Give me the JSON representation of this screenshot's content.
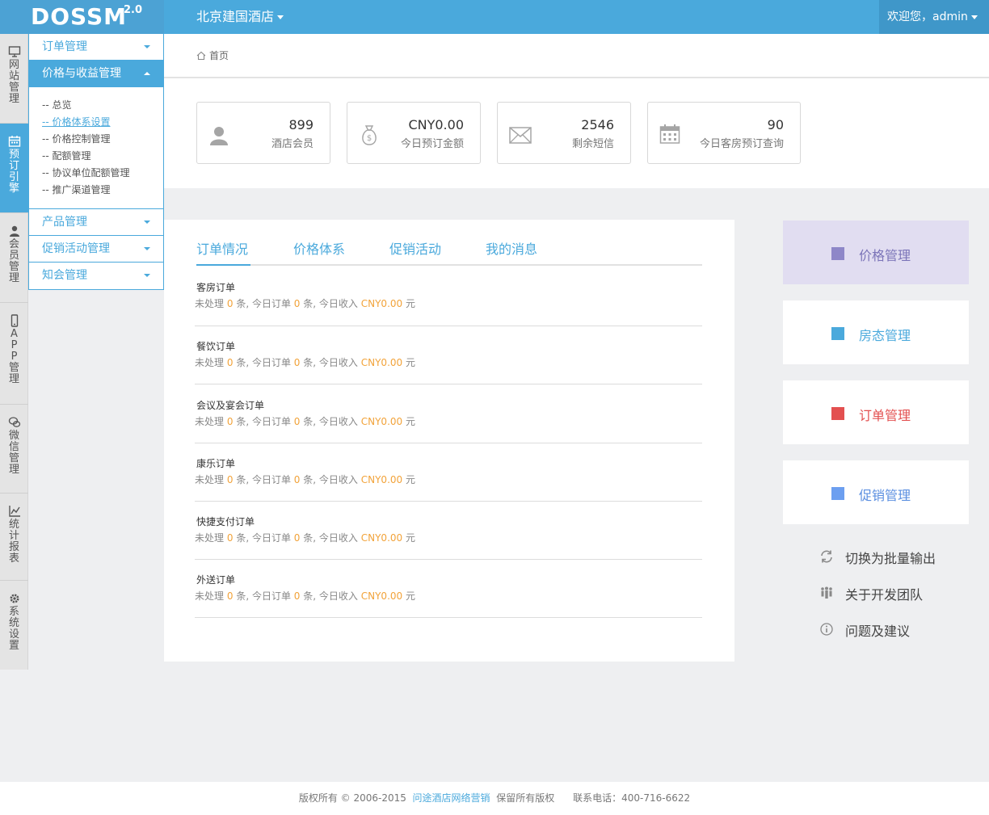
{
  "brand": {
    "logo": "DOSSM",
    "version": "2.0"
  },
  "header": {
    "hotel": "北京建国酒店",
    "welcome": "欢迎您，admin"
  },
  "rail": [
    {
      "label": "网站管理",
      "icon": "monitor-icon"
    },
    {
      "label": "预订引擎",
      "icon": "calendar-icon"
    },
    {
      "label": "会员管理",
      "icon": "user-icon"
    },
    {
      "label": "APP管理",
      "icon": "phone-icon"
    },
    {
      "label": "微信管理",
      "icon": "chat-icon"
    },
    {
      "label": "统计报表",
      "icon": "chart-icon"
    },
    {
      "label": "系统设置",
      "icon": "settings-icon"
    }
  ],
  "submenu": {
    "order": "订单管理",
    "pricing": "价格与收益管理",
    "pricing_items": [
      "-- 总览",
      "-- 价格体系设置",
      "-- 价格控制管理",
      "-- 配额管理",
      "-- 协议单位配额管理",
      "-- 推广渠道管理"
    ],
    "product": "产品管理",
    "promo": "促销活动管理",
    "meeting": "知会管理"
  },
  "breadcrumb": {
    "home": "首页"
  },
  "stats": [
    {
      "value": "899",
      "label": "酒店会员"
    },
    {
      "value": "CNY0.00",
      "label": "今日预订金额"
    },
    {
      "value": "2546",
      "label": "剩余短信"
    },
    {
      "value": "90",
      "label": "今日客房预订查询"
    }
  ],
  "tabs": [
    "订单情况",
    "价格体系",
    "促销活动",
    "我的消息"
  ],
  "info": {
    "pending": "未处理",
    "unit": "条",
    "today_orders": ", 今日订单",
    "today_income": ", 今日收入",
    "yuan": "元"
  },
  "orders": [
    {
      "title": "客房订单",
      "pending": "0",
      "today": "0",
      "income": "CNY0.00"
    },
    {
      "title": "餐饮订单",
      "pending": "0",
      "today": "0",
      "income": "CNY0.00"
    },
    {
      "title": "会议及宴会订单",
      "pending": "0",
      "today": "0",
      "income": "CNY0.00"
    },
    {
      "title": "康乐订单",
      "pending": "0",
      "today": "0",
      "income": "CNY0.00"
    },
    {
      "title": "快捷支付订单",
      "pending": "0",
      "today": "0",
      "income": "CNY0.00"
    },
    {
      "title": "外送订单",
      "pending": "0",
      "today": "0",
      "income": "CNY0.00"
    }
  ],
  "quick": [
    {
      "label": "价格管理",
      "color": "#8e87c8"
    },
    {
      "label": "房态管理",
      "color": "#4aa9dc"
    },
    {
      "label": "订单管理",
      "color": "#e35050"
    },
    {
      "label": "促销管理",
      "color": "#6c9ff0"
    }
  ],
  "links": [
    "切换为批量输出",
    "关于开发团队",
    "问题及建议"
  ],
  "footer": {
    "copyright": "版权所有 © 2006-2015",
    "company": "问途酒店网络营销",
    "rights": "保留所有版权",
    "phone": "联系电话：400-716-6622"
  }
}
